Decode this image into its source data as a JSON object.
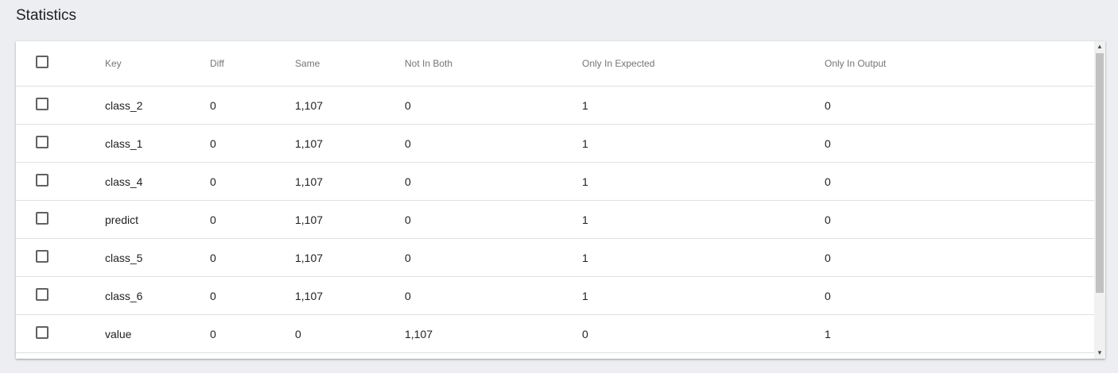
{
  "title": "Statistics",
  "table": {
    "columns": [
      "",
      "Key",
      "Diff",
      "Same",
      "Not In Both",
      "Only In Expected",
      "Only In Output"
    ],
    "rows": [
      {
        "key": "class_2",
        "diff": "0",
        "same": "1,107",
        "not_in_both": "0",
        "only_in_expected": "1",
        "only_in_output": "0"
      },
      {
        "key": "class_1",
        "diff": "0",
        "same": "1,107",
        "not_in_both": "0",
        "only_in_expected": "1",
        "only_in_output": "0"
      },
      {
        "key": "class_4",
        "diff": "0",
        "same": "1,107",
        "not_in_both": "0",
        "only_in_expected": "1",
        "only_in_output": "0"
      },
      {
        "key": "predict",
        "diff": "0",
        "same": "1,107",
        "not_in_both": "0",
        "only_in_expected": "1",
        "only_in_output": "0"
      },
      {
        "key": "class_5",
        "diff": "0",
        "same": "1,107",
        "not_in_both": "0",
        "only_in_expected": "1",
        "only_in_output": "0"
      },
      {
        "key": "class_6",
        "diff": "0",
        "same": "1,107",
        "not_in_both": "0",
        "only_in_expected": "1",
        "only_in_output": "0"
      },
      {
        "key": "value",
        "diff": "0",
        "same": "0",
        "not_in_both": "1,107",
        "only_in_expected": "0",
        "only_in_output": "1"
      }
    ]
  },
  "scrollbar": {
    "up_icon": "scroll-up-arrow-icon",
    "down_icon": "scroll-down-arrow-icon"
  }
}
